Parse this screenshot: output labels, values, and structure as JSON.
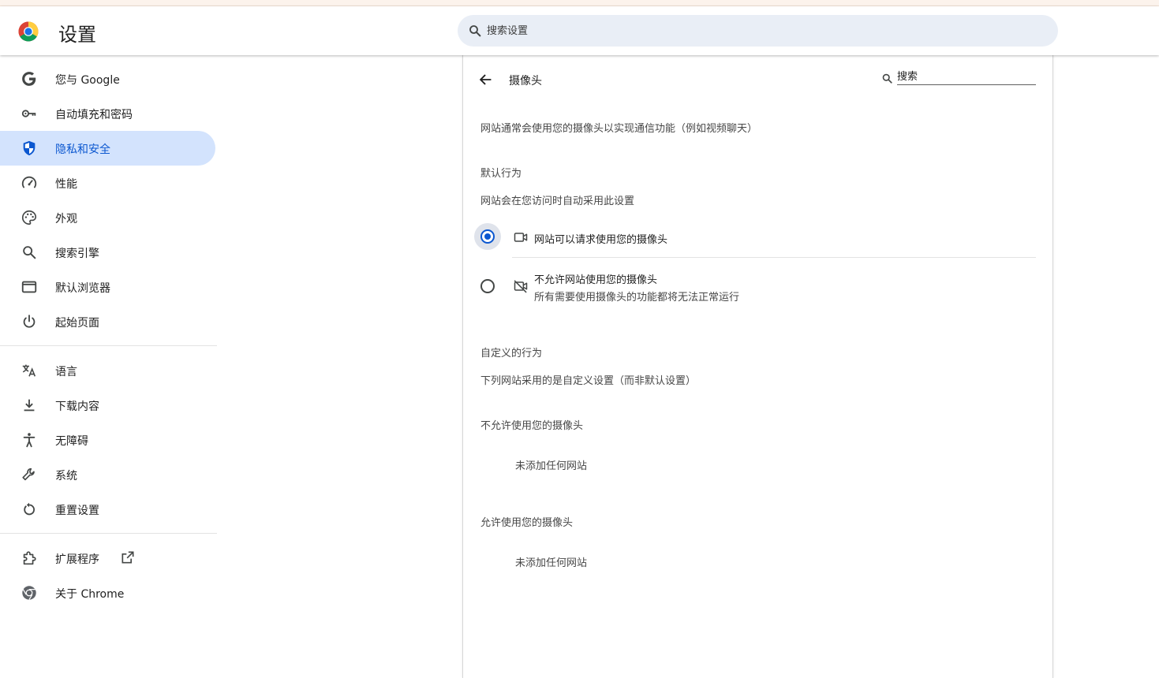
{
  "app": {
    "title": "设置"
  },
  "search": {
    "placeholder": "搜索设置"
  },
  "sidebar": {
    "items": [
      {
        "label": "您与 Google",
        "icon": "google-icon"
      },
      {
        "label": "自动填充和密码",
        "icon": "key-icon"
      },
      {
        "label": "隐私和安全",
        "icon": "shield-icon",
        "active": true
      },
      {
        "label": "性能",
        "icon": "speedometer-icon"
      },
      {
        "label": "外观",
        "icon": "palette-icon"
      },
      {
        "label": "搜索引擎",
        "icon": "search-icon"
      },
      {
        "label": "默认浏览器",
        "icon": "browser-window-icon"
      },
      {
        "label": "起始页面",
        "icon": "power-icon"
      }
    ],
    "items2": [
      {
        "label": "语言",
        "icon": "translate-icon"
      },
      {
        "label": "下载内容",
        "icon": "download-icon"
      },
      {
        "label": "无障碍",
        "icon": "accessibility-icon"
      },
      {
        "label": "系统",
        "icon": "wrench-icon"
      },
      {
        "label": "重置设置",
        "icon": "reset-icon"
      }
    ],
    "items3": [
      {
        "label": "扩展程序",
        "icon": "extension-icon"
      },
      {
        "label": "关于 Chrome",
        "icon": "chrome-icon"
      }
    ]
  },
  "camera": {
    "title": "摄像头",
    "search_placeholder": "搜索",
    "description": "网站通常会使用您的摄像头以实现通信功能（例如视频聊天）",
    "default_heading": "默认行为",
    "default_sub": "网站会在您访问时自动采用此设置",
    "option_allow": "网站可以请求使用您的摄像头",
    "option_block": "不允许网站使用您的摄像头",
    "option_block_sub": "所有需要使用摄像头的功能都将无法正常运行",
    "selected": "allow",
    "custom_heading": "自定义的行为",
    "custom_sub": "下列网站采用的是自定义设置（而非默认设置）",
    "blocked_heading": "不允许使用您的摄像头",
    "blocked_empty": "未添加任何网站",
    "allowed_heading": "允许使用您的摄像头",
    "allowed_empty": "未添加任何网站"
  },
  "colors": {
    "accent": "#0b57d0",
    "active_bg": "#d3e3fd",
    "search_bg": "#e9eef6"
  }
}
